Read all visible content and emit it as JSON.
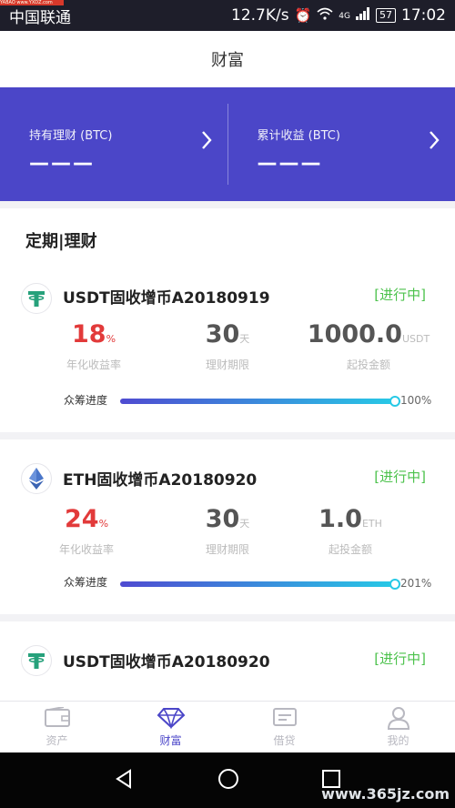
{
  "status_bar": {
    "carrier": "中国联通",
    "speed": "12.7K/s",
    "network": "4G",
    "battery": "57",
    "time": "17:02",
    "corner_logo_text": "YABAO www.YXDZ.com"
  },
  "header": {
    "title": "财富"
  },
  "summary": {
    "holding": {
      "label": "持有理财 (BTC)",
      "value": "———"
    },
    "earnings": {
      "label": "累计收益 (BTC)",
      "value": "———"
    }
  },
  "section": {
    "title": "定期|理财"
  },
  "products": [
    {
      "coin_icon": "tether-icon",
      "coin_color": "#26a17b",
      "name": "USDT固收增币A20180919",
      "status": "[进行中]",
      "rate": "18",
      "rate_unit": "%",
      "rate_label": "年化收益率",
      "term": "30",
      "term_unit": "天",
      "term_label": "理财期限",
      "min": "1000.0",
      "min_unit": "USDT",
      "min_label": "起投金额",
      "progress_label": "众筹进度",
      "progress_text": "100%",
      "progress_fraction": 1.0
    },
    {
      "coin_icon": "ethereum-icon",
      "coin_color": "#4a76c9",
      "name": "ETH固收增币A20180920",
      "status": "[进行中]",
      "rate": "24",
      "rate_unit": "%",
      "rate_label": "年化收益率",
      "term": "30",
      "term_unit": "天",
      "term_label": "理财期限",
      "min": "1.0",
      "min_unit": "ETH",
      "min_label": "起投金额",
      "progress_label": "众筹进度",
      "progress_text": "201%",
      "progress_fraction": 1.0
    },
    {
      "coin_icon": "tether-icon",
      "coin_color": "#26a17b",
      "name": "USDT固收增币A20180920",
      "status": "[进行中]"
    }
  ],
  "tabs": [
    {
      "label": "资产",
      "icon": "wallet-icon",
      "active": false
    },
    {
      "label": "财富",
      "icon": "diamond-icon",
      "active": true
    },
    {
      "label": "借贷",
      "icon": "loan-icon",
      "active": false
    },
    {
      "label": "我的",
      "icon": "user-icon",
      "active": false
    }
  ],
  "watermark": "www.365jz.com",
  "colors": {
    "accent": "#4b46c8",
    "status_green": "#4cc24c",
    "rate_red": "#e23a3a",
    "progress_start": "#4f4bd1",
    "progress_end": "#27c9e6"
  }
}
